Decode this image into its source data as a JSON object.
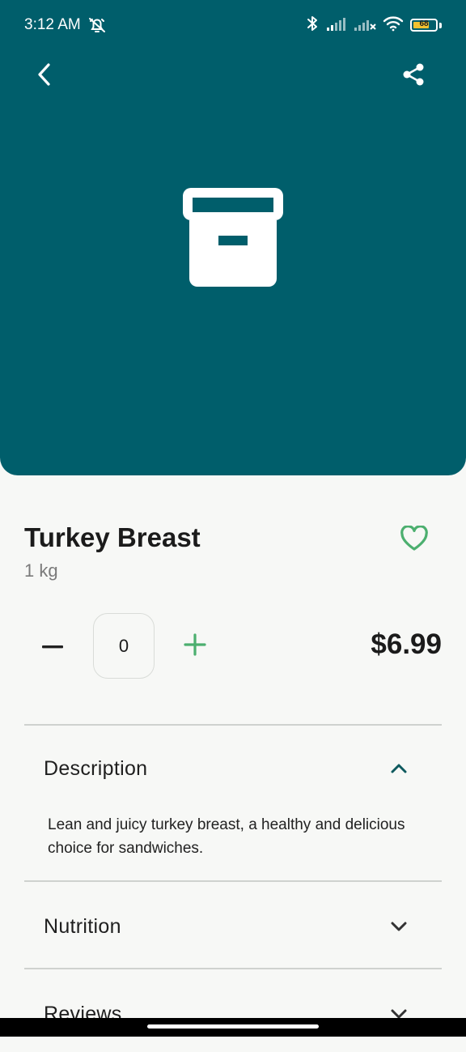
{
  "status_bar": {
    "time": "3:12 AM",
    "battery_level": "68"
  },
  "header": {
    "back_icon": "chevron-left-icon",
    "share_icon": "share-icon",
    "product_image_icon": "archive-box-icon"
  },
  "product": {
    "name": "Turkey Breast",
    "weight": "1 kg",
    "price": "$6.99",
    "quantity": "0",
    "favorited": false
  },
  "sections": {
    "description": {
      "title": "Description",
      "expanded": true,
      "text": "Lean and juicy turkey breast, a healthy and delicious choice for sandwiches."
    },
    "nutrition": {
      "title": "Nutrition",
      "expanded": false
    },
    "reviews": {
      "title": "Reviews",
      "expanded": false
    }
  },
  "colors": {
    "hero_background": "#005e6b",
    "accent_green": "#4caf6f",
    "page_background": "#f7f8f6",
    "chevron_teal": "#0e5a5e"
  }
}
